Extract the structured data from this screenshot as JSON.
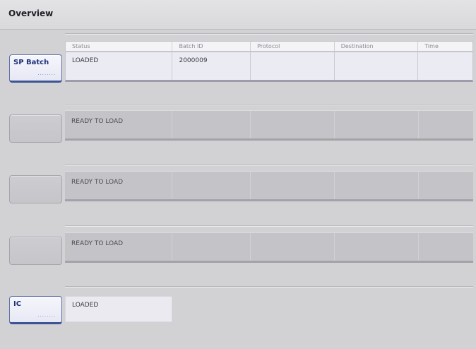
{
  "header": {
    "title": "Overview"
  },
  "table": {
    "columns": [
      "Status",
      "Batch ID",
      "Protocol",
      "Destination",
      "Time"
    ]
  },
  "slots": [
    {
      "button_label": "SP Batch",
      "button_dots": "········",
      "status": "LOADED",
      "batch_id": "2000009",
      "protocol": "",
      "destination": "",
      "time": ""
    },
    {
      "button_label": "",
      "status": "READY TO LOAD",
      "batch_id": "",
      "protocol": "",
      "destination": "",
      "time": ""
    },
    {
      "button_label": "",
      "status": "READY TO LOAD",
      "batch_id": "",
      "protocol": "",
      "destination": "",
      "time": ""
    },
    {
      "button_label": "",
      "status": "READY TO LOAD",
      "batch_id": "",
      "protocol": "",
      "destination": "",
      "time": ""
    }
  ],
  "ic": {
    "button_label": "IC",
    "button_dots": "········",
    "status": "LOADED"
  }
}
